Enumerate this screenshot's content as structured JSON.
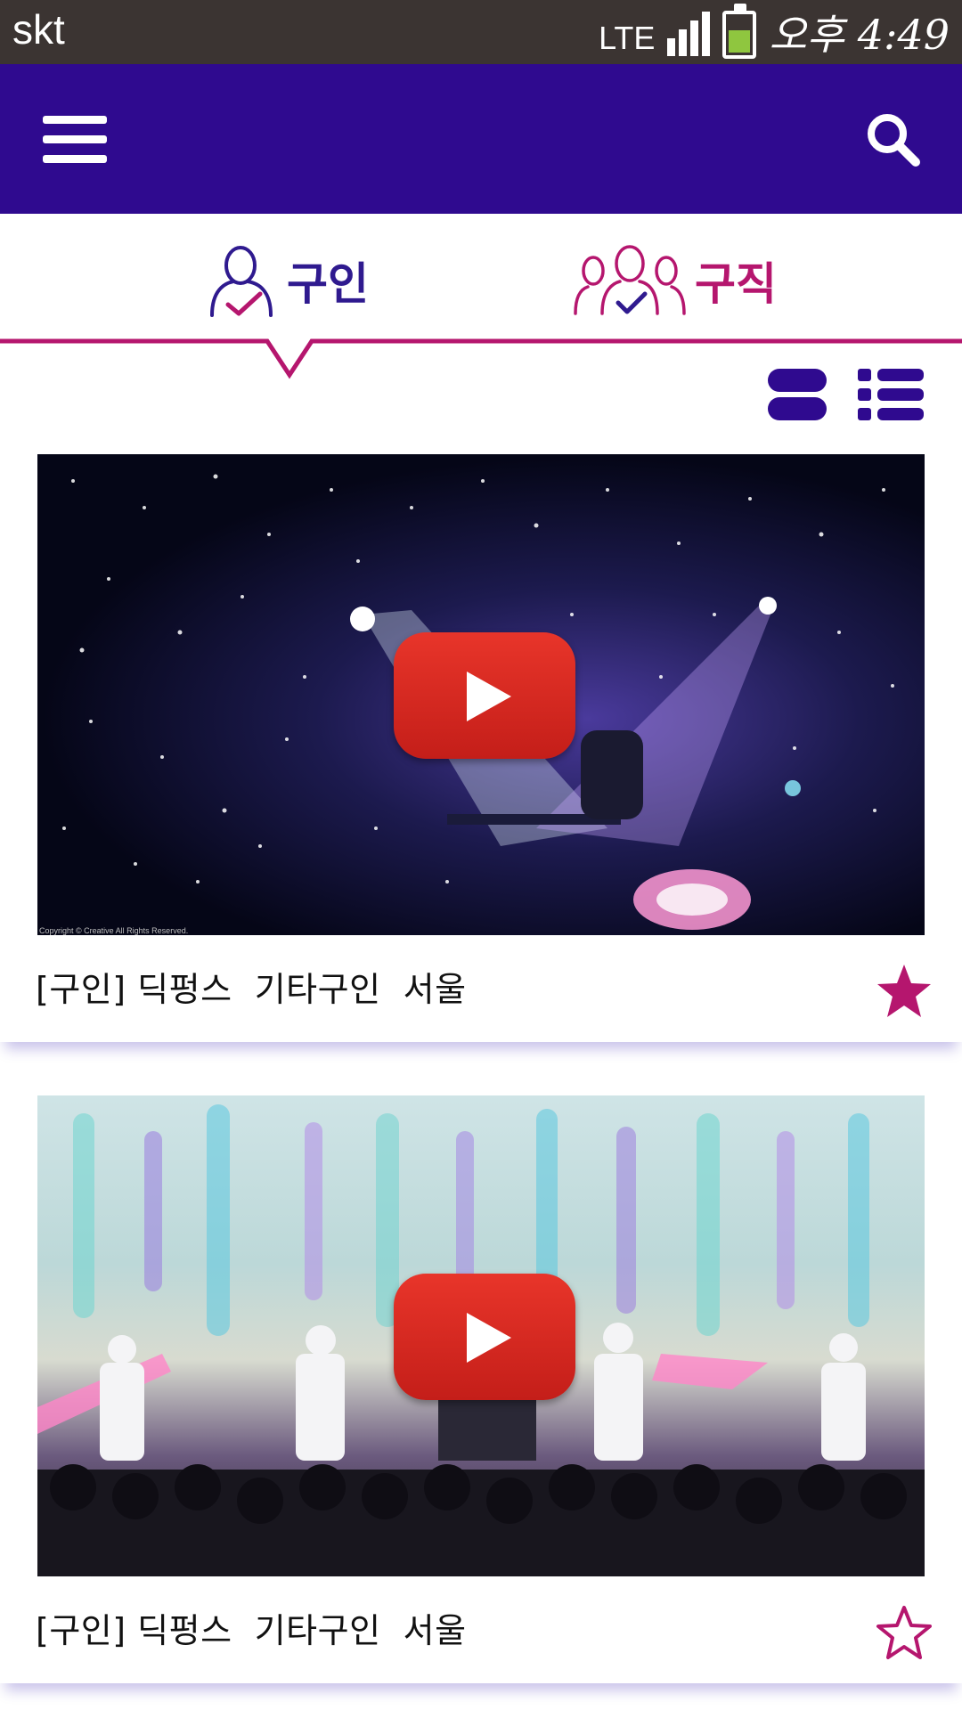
{
  "status_bar": {
    "carrier": "skt",
    "network": "LTE",
    "time": "오후 4:49",
    "icons": [
      "signal-icon",
      "battery-icon"
    ]
  },
  "app_bar": {
    "icons": [
      "menu-icon",
      "search-icon"
    ]
  },
  "tabs": [
    {
      "label": "구인",
      "icon": "person-check-icon",
      "selected": true
    },
    {
      "label": "구직",
      "icon": "group-check-icon",
      "selected": false
    }
  ],
  "view_toggle": {
    "icons": [
      "card-view-icon",
      "list-view-icon"
    ]
  },
  "videos": [
    {
      "caption": "[구인] 딕펑스  기타구인  서울",
      "favorited": true,
      "copyright": "Copyright © Creative All Rights Reserved."
    },
    {
      "caption": "[구인] 딕펑스  기타구인  서울",
      "favorited": false
    }
  ],
  "colors": {
    "app_bar": "#2f0a8f",
    "status_bar": "#3b3432",
    "accent_magenta": "#b5166e",
    "tab_hire": "#2f1a8f",
    "play_button": "#d42a22"
  }
}
